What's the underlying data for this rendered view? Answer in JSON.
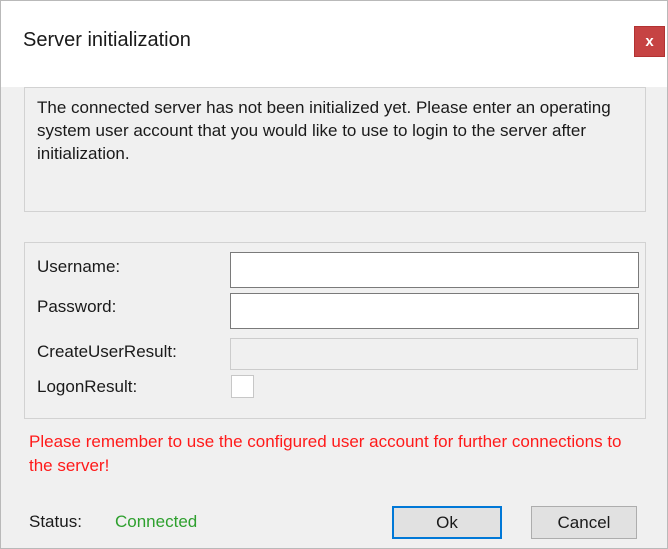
{
  "dialog": {
    "title": "Server initialization",
    "close_label": "x",
    "info_message": "The connected server has not been initialized yet. Please enter an operating system user account that you would like to use to login to the server after initialization."
  },
  "form": {
    "username": {
      "label": "Username:",
      "value": ""
    },
    "password": {
      "label": "Password:",
      "value": ""
    },
    "create_user_result": {
      "label": "CreateUserResult:",
      "value": ""
    },
    "logon_result": {
      "label": "LogonResult:",
      "checked": false
    }
  },
  "warning": "Please remember to use the configured user account for further connections to the server!",
  "status": {
    "label": "Status:",
    "value": "Connected",
    "color": "#2ea02e"
  },
  "buttons": {
    "ok_label": "Ok",
    "cancel_label": "Cancel"
  }
}
